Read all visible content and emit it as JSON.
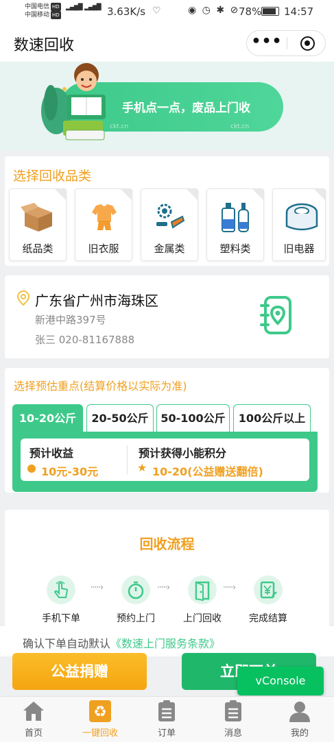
{
  "status_bar": {
    "carrier1": "中国电信",
    "carrier2": "中国移动",
    "hd": "HD",
    "speed": "3.63K/s",
    "battery": "78%",
    "time": "14:57"
  },
  "header": {
    "title": "数速回收",
    "more_label": "•••"
  },
  "banner": {
    "slogan": "手机点一点，废品上门收",
    "watermark": "ckt.cn"
  },
  "categories": {
    "title": "选择回收品类",
    "items": [
      {
        "label": "纸品类",
        "icon": "box-icon"
      },
      {
        "label": "旧衣服",
        "icon": "clothes-icon"
      },
      {
        "label": "金属类",
        "icon": "metal-icon"
      },
      {
        "label": "塑料类",
        "icon": "bottle-icon"
      },
      {
        "label": "旧电器",
        "icon": "appliance-icon"
      }
    ]
  },
  "address": {
    "region": "广东省广州市海珠区",
    "street": "新港中路397号",
    "contact": "张三    020-81167888"
  },
  "weight": {
    "title": "选择预估重点(结算价格以实际为准)",
    "tabs": [
      "10-20公斤",
      "20-50公斤",
      "50-100公斤",
      "100公斤以上"
    ],
    "active_tab": 0,
    "income_label": "预计收益",
    "income_value": "10元-30元",
    "points_label": "预计获得小能积分",
    "points_value": "10-20(公益赠送翻倍)"
  },
  "flow": {
    "title": "回收流程",
    "steps": [
      "手机下单",
      "预约上门",
      "上门回收",
      "完成结算"
    ]
  },
  "terms": {
    "prefix": "确认下单自动默认",
    "link": "《数速上门服务条款》"
  },
  "buttons": {
    "donate": "公益捐赠",
    "order": "立即下单",
    "vconsole": "vConsole"
  },
  "tabbar": {
    "items": [
      "首页",
      "一键回收",
      "订单",
      "消息",
      "我的"
    ],
    "active": 1
  },
  "colors": {
    "brand_green": "#3ec98a",
    "accent_orange": "#f0a020"
  }
}
